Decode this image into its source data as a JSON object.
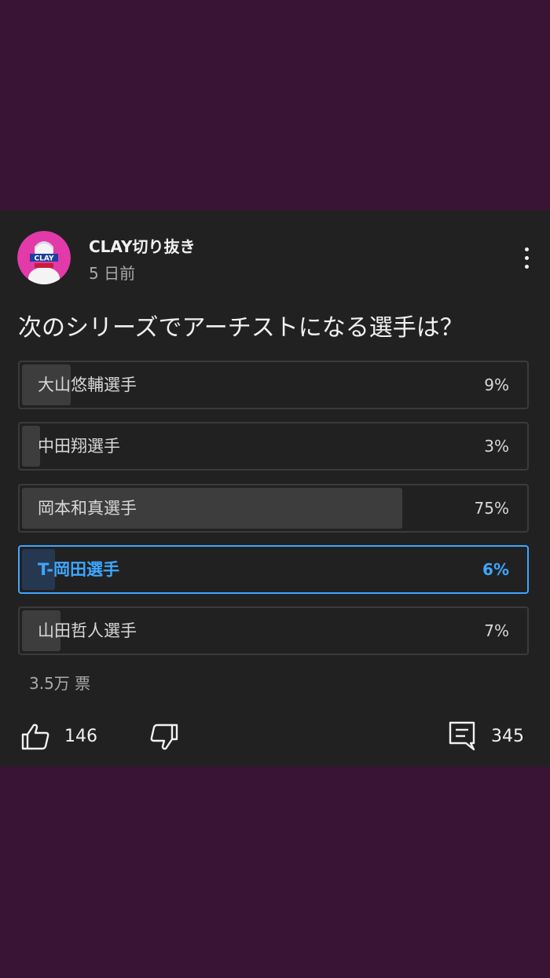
{
  "post": {
    "channel_name": "CLAY切り抜き",
    "time": "5 日前",
    "question": "次のシリーズでアーチストになる選手は？",
    "avatar_text": "CLAY"
  },
  "poll": {
    "options": [
      {
        "label": "大山悠輔選手",
        "percent_text": "9%",
        "percent": 9,
        "selected": false
      },
      {
        "label": "中田翔選手",
        "percent_text": "3%",
        "percent": 3,
        "selected": false
      },
      {
        "label": "岡本和真選手",
        "percent_text": "75%",
        "percent": 75,
        "selected": false
      },
      {
        "label": "T-岡田選手",
        "percent_text": "6%",
        "percent": 6,
        "selected": true
      },
      {
        "label": "山田哲人選手",
        "percent_text": "7%",
        "percent": 7,
        "selected": false
      }
    ],
    "vote_count": "3.5万 票"
  },
  "actions": {
    "like_count": "146",
    "comment_count": "345",
    "icons": [
      "thumbs-up-icon",
      "thumbs-down-icon",
      "comment-icon",
      "more-vert-icon"
    ]
  },
  "colors": {
    "background": "#3a1434",
    "card": "#212121",
    "accent": "#3ea6ff"
  }
}
